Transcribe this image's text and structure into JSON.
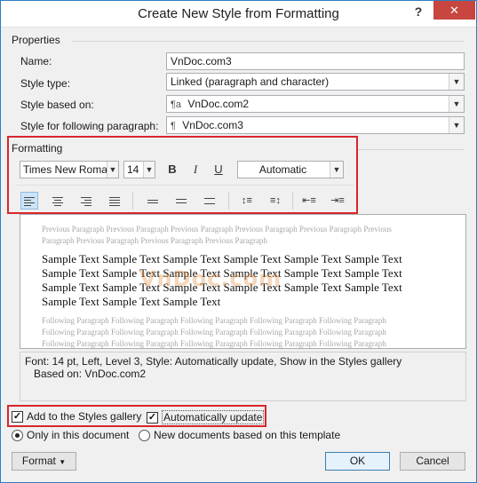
{
  "window": {
    "title": "Create New Style from Formatting",
    "help": "?",
    "close": "✕"
  },
  "properties": {
    "section_label": "Properties",
    "name_label": "Name:",
    "name_value": "VnDoc.com3",
    "style_type_label": "Style type:",
    "style_type_value": "Linked (paragraph and character)",
    "style_based_on_label": "Style based on:",
    "style_based_on_value": "VnDoc.com2",
    "following_label": "Style for following paragraph:",
    "following_value": "VnDoc.com3"
  },
  "formatting": {
    "section_label": "Formatting",
    "font": "Times New Roman",
    "size": "14",
    "bold": "B",
    "italic": "I",
    "underline": "U",
    "color": "Automatic"
  },
  "preview": {
    "previous_line1": "Previous Paragraph Previous Paragraph Previous Paragraph Previous Paragraph Previous Paragraph Previous",
    "previous_line2": "Paragraph Previous Paragraph Previous Paragraph Previous Paragraph",
    "sample_line1": "Sample Text Sample Text Sample Text Sample Text Sample Text Sample Text",
    "sample_line2": "Sample Text Sample Text Sample Text Sample Text Sample Text Sample Text",
    "sample_line3": "Sample Text Sample Text Sample Text Sample Text Sample Text Sample Text",
    "sample_line4": "Sample Text Sample Text Sample Text",
    "following_line1": "Following Paragraph Following Paragraph Following Paragraph Following Paragraph Following Paragraph",
    "following_line2": "Following Paragraph Following Paragraph Following Paragraph Following Paragraph Following Paragraph",
    "following_line3": "Following Paragraph Following Paragraph Following Paragraph Following Paragraph Following Paragraph",
    "watermark": "VnDoc.com"
  },
  "description": {
    "line1": "Font: 14 pt, Left, Level 3, Style: Automatically update, Show in the Styles gallery",
    "line2": "Based on: VnDoc.com2"
  },
  "options": {
    "add_to_gallery": "Add to the Styles gallery",
    "add_to_gallery_checked": true,
    "auto_update": "Automatically update",
    "auto_update_checked": true,
    "only_this_doc": "Only in this document",
    "new_docs": "New documents based on this template",
    "scope_selected": "only_this_doc"
  },
  "buttons": {
    "format": "Format",
    "ok": "OK",
    "cancel": "Cancel"
  },
  "colors": {
    "highlight_red": "#d9262c",
    "close_red": "#c7463f",
    "accent_blue": "#2e7dbf"
  }
}
